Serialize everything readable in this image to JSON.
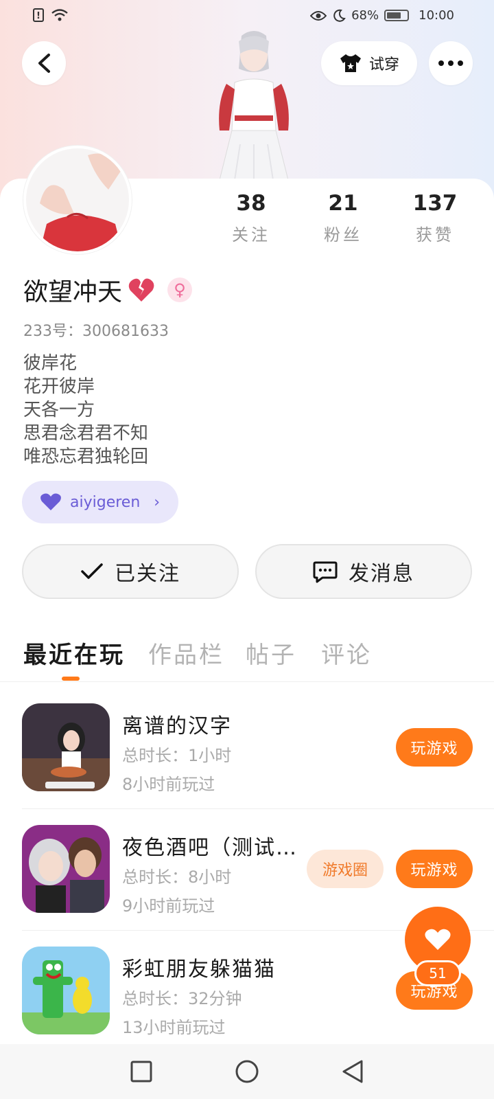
{
  "status_bar": {
    "battery_text": "68%",
    "time": "10:00",
    "icons": [
      "alert-icon",
      "wifi-icon",
      "eye-icon",
      "moon-icon",
      "battery-icon"
    ]
  },
  "top_bar": {
    "try_on_label": "试穿",
    "icons": [
      "back-arrow-icon",
      "tshirt-icon",
      "more-dots-icon"
    ]
  },
  "profile": {
    "stats": [
      {
        "num": "38",
        "label": "关注"
      },
      {
        "num": "21",
        "label": "粉丝"
      },
      {
        "num": "137",
        "label": "获赞"
      }
    ],
    "username": "欲望冲天",
    "uid_label": "233号：",
    "uid_value": "300681633",
    "bio": [
      "彼岸花",
      "花开彼岸",
      "天各一方",
      "思君念君君不知",
      "唯恐忘君独轮回"
    ],
    "tag": "aiyigeren"
  },
  "actions": {
    "follow_label": "已关注",
    "message_label": "发消息"
  },
  "tabs": [
    "最近在玩",
    "作品栏",
    "帖子",
    "评论"
  ],
  "games": [
    {
      "title": "离谱的汉字",
      "duration": "总时长：1小时",
      "last_played": "8小时前玩过",
      "play_label": "玩游戏"
    },
    {
      "title": "夜色酒吧（测试…",
      "duration": "总时长：8小时",
      "last_played": "9小时前玩过",
      "circle_label": "游戏圈",
      "play_label": "玩游戏"
    },
    {
      "title": "彩虹朋友躲猫猫",
      "duration": "总时长：32分钟",
      "last_played": "13小时前玩过",
      "play_label": "玩游戏"
    }
  ],
  "fab": {
    "count": "51"
  },
  "colors": {
    "accent": "#ff7a1a",
    "tag_bg": "#e9e7fb",
    "tag_text": "#6a5cd6"
  }
}
